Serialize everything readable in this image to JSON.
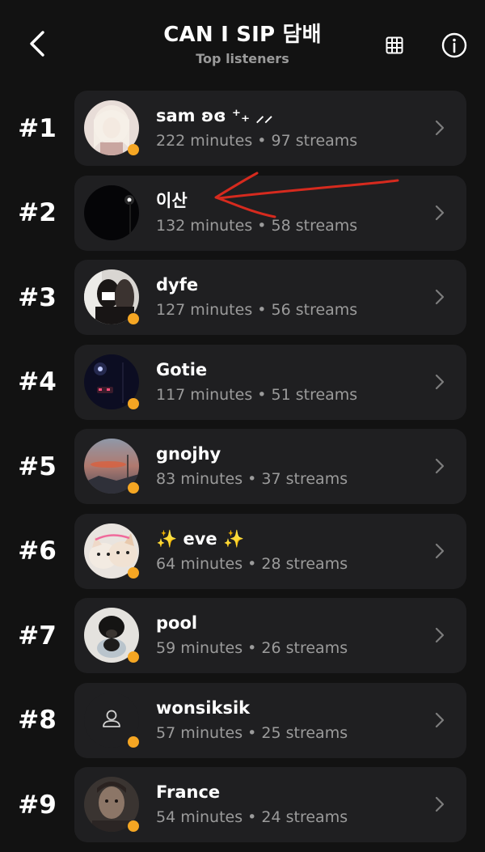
{
  "header": {
    "title": "CAN I SIP 담배",
    "subtitle": "Top listeners"
  },
  "icons": {
    "back": "chevron-left-icon",
    "grid": "grid-icon",
    "info": "info-icon",
    "row_chevron": "chevron-right-icon",
    "default_avatar": "person-icon"
  },
  "colors": {
    "background": "#121212",
    "card": "#1f1f21",
    "status_dot": "#f5a623",
    "annotation_arrow": "#d62a1e"
  },
  "listeners": [
    {
      "rank": "#1",
      "name": "sam ʚɞ ⁺₊ ⸝⸝",
      "stats": "222 minutes • 97 streams",
      "avatar": "photo"
    },
    {
      "rank": "#2",
      "name": "이산",
      "stats": "132 minutes • 58 streams",
      "avatar": "photo"
    },
    {
      "rank": "#3",
      "name": "dyfe",
      "stats": "127 minutes • 56 streams",
      "avatar": "photo"
    },
    {
      "rank": "#4",
      "name": "Gotie",
      "stats": "117 minutes • 51 streams",
      "avatar": "photo"
    },
    {
      "rank": "#5",
      "name": "gnojhy",
      "stats": "83 minutes • 37 streams",
      "avatar": "photo"
    },
    {
      "rank": "#6",
      "name": "✨ eve ✨",
      "stats": "64 minutes • 28 streams",
      "avatar": "photo"
    },
    {
      "rank": "#7",
      "name": "pool",
      "stats": "59 minutes • 26 streams",
      "avatar": "photo"
    },
    {
      "rank": "#8",
      "name": "wonsiksik",
      "stats": "57 minutes • 25 streams",
      "avatar": "default"
    },
    {
      "rank": "#9",
      "name": "France",
      "stats": "54 minutes • 24 streams",
      "avatar": "photo"
    }
  ]
}
